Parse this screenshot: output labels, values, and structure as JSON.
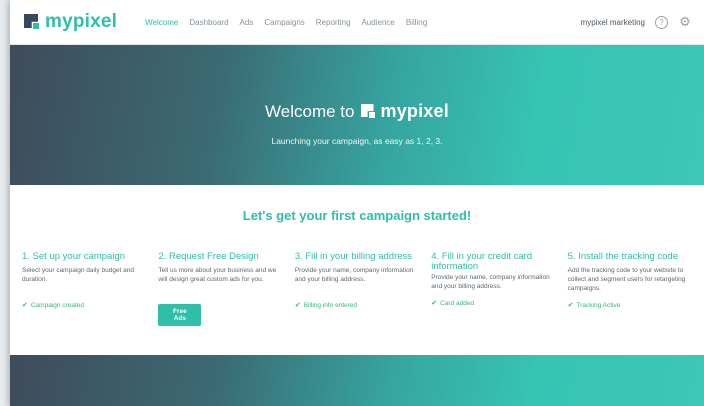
{
  "brand": {
    "name": "mypixel"
  },
  "nav": {
    "links": [
      "Welcome",
      "Dashboard",
      "Ads",
      "Campaigns",
      "Reporting",
      "Audience",
      "Billing"
    ],
    "active": "Welcome",
    "account": "mypixel marketing",
    "help_icon": "question-circle-icon",
    "settings_icon": "gear-icon"
  },
  "hero": {
    "title_prefix": "Welcome to",
    "subtitle": "Launching your campaign, as easy as 1, 2, 3."
  },
  "steps_heading": "Let's get your first campaign started!",
  "steps": [
    {
      "title": "1. Set up your campaign",
      "desc": "Select your campaign daily budget and duration.",
      "status": "Campaign created"
    },
    {
      "title": "2. Request Free Design",
      "desc": "Tell us more about your business and we will design great custom ads for you.",
      "button": "Free Ads"
    },
    {
      "title": "3. Fill in your billing address",
      "desc": "Provide your name, company information and your billing address.",
      "status": "Billing info entered"
    },
    {
      "title": "4. Fill in your credit card information",
      "desc": "Provide your name, company information and your billing address.",
      "status": "Card added"
    },
    {
      "title": "5. Install the tracking code",
      "desc": "Add the tracking code to your website to collect and segment users for retargeting campaigns.",
      "status": "Tracking Active"
    }
  ],
  "colors": {
    "accent": "#2fbfa8",
    "dark": "#35495e",
    "success": "#37b97a"
  }
}
